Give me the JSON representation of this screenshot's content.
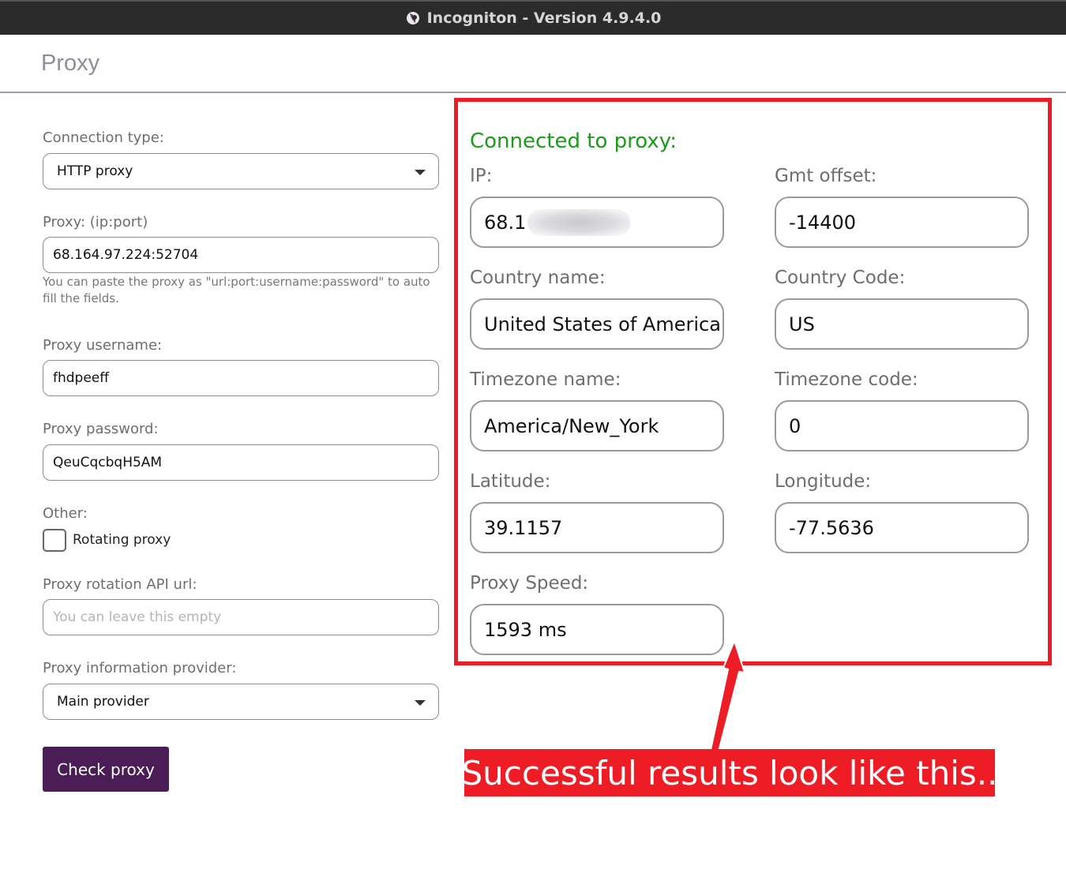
{
  "window": {
    "title": "Incogniton - Version 4.9.4.0",
    "app_icon": "incogniton-logo-icon"
  },
  "page": {
    "title": "Proxy"
  },
  "form": {
    "connection_type": {
      "label": "Connection type:",
      "value": "HTTP proxy"
    },
    "proxy": {
      "label": "Proxy: (ip:port)",
      "value": "68.164.97.224:52704",
      "hint": "You can paste the proxy as \"url:port:username:password\" to auto fill the fields."
    },
    "username": {
      "label": "Proxy username:",
      "value": "fhdpeeff"
    },
    "password": {
      "label": "Proxy password:",
      "value": "QeuCqcbqH5AM"
    },
    "other": {
      "label": "Other:",
      "rotating_label": "Rotating proxy",
      "rotating_checked": false
    },
    "rotation_url": {
      "label": "Proxy rotation API url:",
      "placeholder": "You can leave this empty",
      "value": ""
    },
    "info_provider": {
      "label": "Proxy information provider:",
      "value": "Main provider"
    },
    "check_button": "Check proxy"
  },
  "result": {
    "status": "Connected to proxy:",
    "status_color": "#1a9c1a",
    "ip": {
      "label": "IP:",
      "value": "68.1"
    },
    "gmt_offset": {
      "label": "Gmt offset:",
      "value": "-14400"
    },
    "country_name": {
      "label": "Country name:",
      "value": "United States of America"
    },
    "country_code": {
      "label": "Country Code:",
      "value": "US"
    },
    "timezone_name": {
      "label": "Timezone name:",
      "value": "America/New_York"
    },
    "timezone_code": {
      "label": "Timezone code:",
      "value": "0"
    },
    "latitude": {
      "label": "Latitude:",
      "value": "39.1157"
    },
    "longitude": {
      "label": "Longitude:",
      "value": "-77.5636"
    },
    "speed": {
      "label": "Proxy Speed:",
      "value": "1593 ms"
    }
  },
  "annotation": {
    "text": "Successful results look like this..",
    "color": "#ee1c24"
  },
  "colors": {
    "accent_button": "#4a1d56",
    "titlebar": "#2b2b2b"
  }
}
